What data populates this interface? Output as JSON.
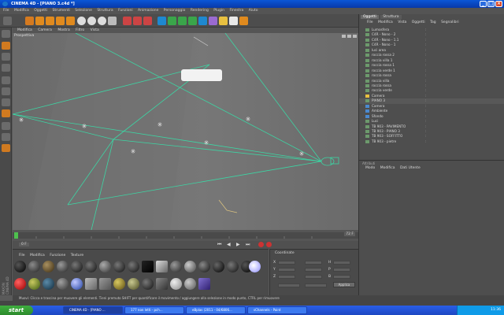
{
  "window": {
    "title": "CINEMA 4D - [PIANO 3.c4d *]"
  },
  "menubar": {
    "items": [
      "File",
      "Modifica",
      "Oggetti",
      "Strumenti",
      "Selezione",
      "Struttura",
      "Funzioni",
      "Animazione",
      "Personaggio",
      "Rendering",
      "Plugin",
      "Finestra",
      "Aiuto"
    ]
  },
  "viewport": {
    "menu": [
      "Modifica",
      "Camera",
      "Mostra",
      "Filtro",
      "Vista"
    ],
    "label": "Prospettiva"
  },
  "timeline": {
    "frame_display": "0 F",
    "end_display": "72 F"
  },
  "materials": {
    "menu": [
      "File",
      "Modifica",
      "Funzione",
      "Texture"
    ]
  },
  "coordinates": {
    "title": "Coordinate",
    "axes": [
      "X",
      "Y",
      "Z"
    ],
    "rows": [
      "H",
      "P",
      "B"
    ],
    "apply_label": "Applica"
  },
  "objects": {
    "tabs": [
      "Oggetti",
      "Struttura"
    ],
    "menu": [
      "File",
      "Modifica",
      "Vista",
      "Oggetti",
      "Tag",
      "Segnalibri"
    ],
    "rows": [
      "Lumosfera",
      "C4R - Nono - 2",
      "C4R - Nono - 1.1",
      "C4R - Nono - 1",
      "luci area",
      "roccia rossa 2",
      "roccia villa 1",
      "roccia rossa 1",
      "roccia verde 1",
      "roccia rossa",
      "roccia villa",
      "roccia rossa",
      "roccia verde",
      "Camera",
      "PIANO 3",
      "Camera",
      "Ambiente",
      "Sfondo",
      "Luci",
      "TB 903 - PAVIMENTO",
      "TB 903 - PIANO 3",
      "TB 903 - SOFFITTO",
      "TB 903 - pietre"
    ]
  },
  "attributes": {
    "menu": [
      "Modo",
      "Modifica",
      "Dati Utente"
    ],
    "title": "Attributi"
  },
  "status": {
    "text": "Muovi: Clicca e trascina per muovere gli elementi. Tieni premuto SHIFT per quantificare il movimento / aggiungere alla selezione in modo punto, CTRL per rimuovere"
  },
  "sidebrand": "MAXON CINEMA 4D",
  "taskbar": {
    "start_label": "start",
    "tasks": [
      "CINEMA 4D - [PIANO ...",
      "177 non letti - pch...",
      "eBplas (2011 - 04/6806...",
      "sChannels - Paint"
    ],
    "clock": "11:36"
  },
  "colors": {
    "accent_green": "#3cd6a4",
    "title_blue": "#0a56d8",
    "orange_icon": "#e08a1e"
  }
}
